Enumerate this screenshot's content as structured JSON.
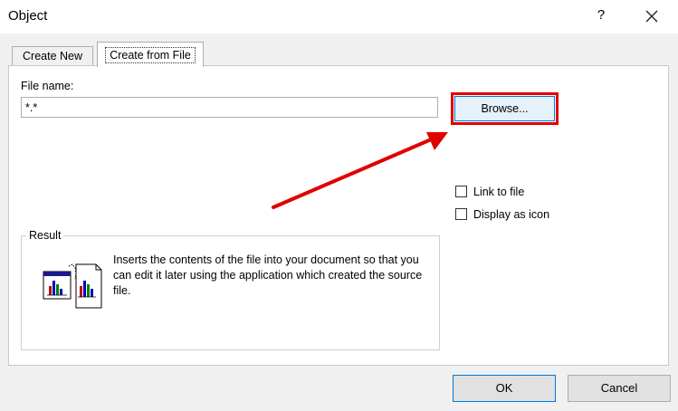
{
  "window": {
    "title": "Object",
    "help_label": "?",
    "close_icon": "close-icon"
  },
  "tabs": [
    {
      "label": "Create New",
      "active": false
    },
    {
      "label": "Create from File",
      "active": true
    }
  ],
  "file": {
    "label": "File name:",
    "value": "*.*",
    "browse_label": "Browse..."
  },
  "options": {
    "link_label": "Link to file",
    "link_checked": false,
    "icon_label": "Display as icon",
    "icon_checked": false
  },
  "result": {
    "legend": "Result",
    "description": "Inserts the contents of the file into your document so that you can edit it later using the application which created the source file.",
    "icon": "embed-document-icon"
  },
  "buttons": {
    "ok_label": "OK",
    "cancel_label": "Cancel"
  },
  "annotation": {
    "highlight_color": "#e00000",
    "arrow_icon": "red-arrow-icon"
  }
}
